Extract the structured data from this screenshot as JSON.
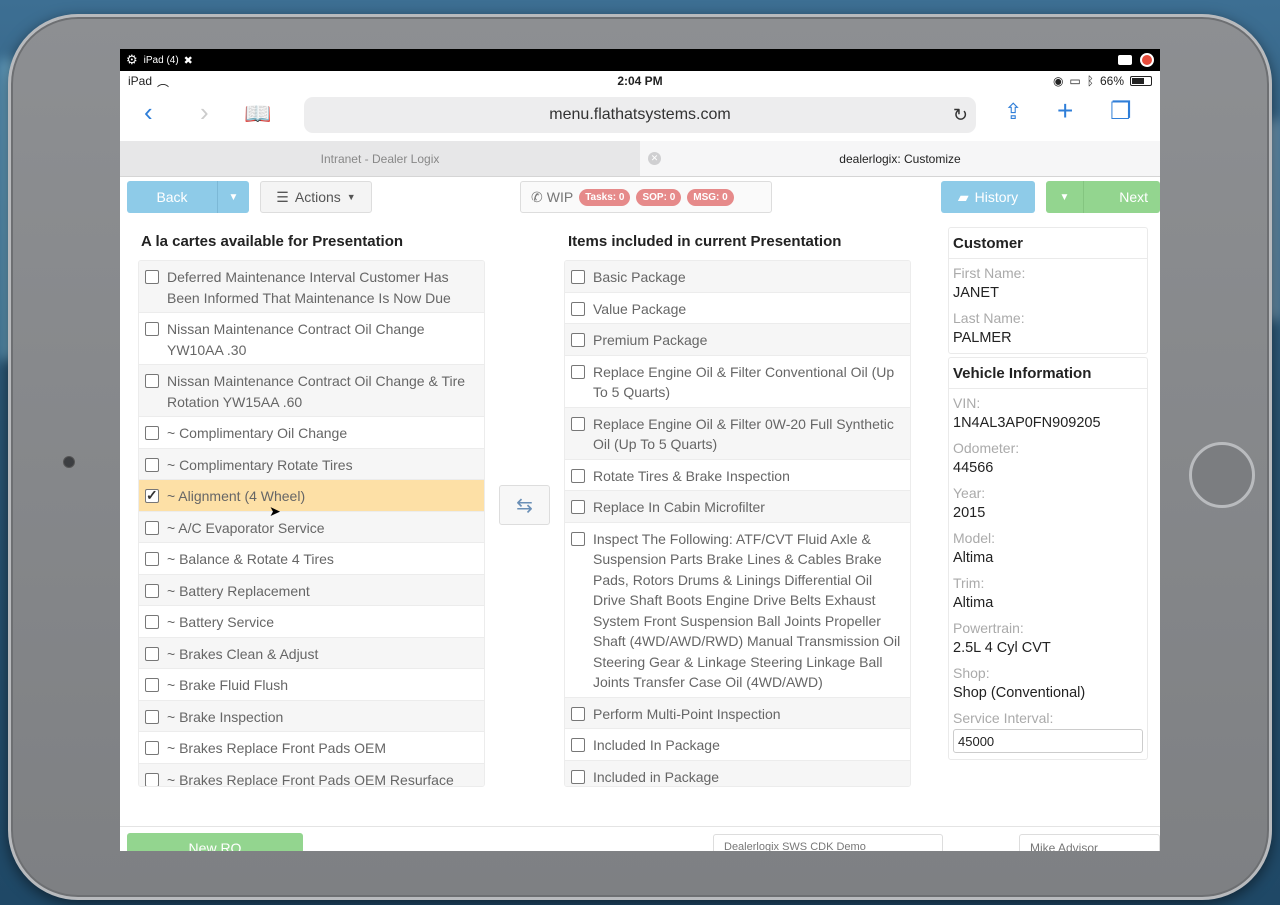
{
  "recording_bar": {
    "device_label": "iPad (4)"
  },
  "status_bar": {
    "device": "iPad",
    "time": "2:04 PM",
    "battery": "66%"
  },
  "browser": {
    "url": "menu.flathatsystems.com",
    "tabs": [
      {
        "label": "Intranet - Dealer Logix",
        "active": false
      },
      {
        "label": "dealerlogix: Customize",
        "active": true
      }
    ]
  },
  "toolbar": {
    "back_label": "Back",
    "actions_label": "Actions",
    "wip_label": "WIP",
    "tasks_badge": "Tasks: 0",
    "sop_badge": "SOP: 0",
    "msg_badge": "MSG: 0",
    "history_label": "History",
    "next_label": "Next"
  },
  "left_column": {
    "title": "A la cartes available for Presentation",
    "items": [
      {
        "label": "Deferred Maintenance Interval Customer Has Been Informed That Maintenance Is Now Due",
        "checked": false
      },
      {
        "label": "Nissan Maintenance Contract Oil Change YW10AA .30",
        "checked": false
      },
      {
        "label": "Nissan Maintenance Contract Oil Change & Tire Rotation YW15AA .60",
        "checked": false
      },
      {
        "label": "~ Complimentary Oil Change",
        "checked": false
      },
      {
        "label": "~ Complimentary Rotate Tires",
        "checked": false
      },
      {
        "label": "~ Alignment (4 Wheel)",
        "checked": true
      },
      {
        "label": "~ A/C Evaporator Service",
        "checked": false
      },
      {
        "label": "~ Balance & Rotate 4 Tires",
        "checked": false
      },
      {
        "label": "~ Battery Replacement",
        "checked": false
      },
      {
        "label": "~ Battery Service",
        "checked": false
      },
      {
        "label": "~ Brakes Clean & Adjust",
        "checked": false
      },
      {
        "label": "~ Brake Fluid Flush",
        "checked": false
      },
      {
        "label": "~ Brake Inspection",
        "checked": false
      },
      {
        "label": "~ Brakes Replace Front Pads OEM",
        "checked": false
      },
      {
        "label": "~ Brakes Replace Front Pads OEM Resurface Rotors",
        "checked": false
      }
    ]
  },
  "right_column": {
    "title": "Items included in current Presentation",
    "items": [
      {
        "label": "Basic Package",
        "checked": false
      },
      {
        "label": "Value Package",
        "checked": false
      },
      {
        "label": "Premium Package",
        "checked": false
      },
      {
        "label": "Replace Engine Oil & Filter Conventional Oil (Up To 5 Quarts)",
        "checked": false
      },
      {
        "label": "Replace Engine Oil & Filter 0W-20 Full Synthetic Oil (Up To 5 Quarts)",
        "checked": false
      },
      {
        "label": "Rotate Tires & Brake Inspection",
        "checked": false
      },
      {
        "label": "Replace In Cabin Microfilter",
        "checked": false
      },
      {
        "label": "Inspect The Following: ATF/CVT Fluid Axle & Suspension Parts Brake Lines & Cables Brake Pads, Rotors Drums & Linings Differential Oil Drive Shaft Boots Engine Drive Belts Exhaust System Front Suspension Ball Joints Propeller Shaft (4WD/AWD/RWD) Manual Transmission Oil Steering Gear & Linkage Steering Linkage Ball Joints Transfer Case Oil (4WD/AWD)",
        "checked": false
      },
      {
        "label": "Perform Multi-Point Inspection",
        "checked": false
      },
      {
        "label": "Included In Package",
        "checked": false
      },
      {
        "label": "Included in Package",
        "checked": false
      }
    ]
  },
  "customer": {
    "title": "Customer",
    "first_name_label": "First Name:",
    "first_name": "JANET",
    "last_name_label": "Last Name:",
    "last_name": "PALMER"
  },
  "vehicle": {
    "title": "Vehicle Information",
    "vin_label": "VIN:",
    "vin": "1N4AL3AP0FN909205",
    "odometer_label": "Odometer:",
    "odometer": "44566",
    "year_label": "Year:",
    "year": "2015",
    "model_label": "Model:",
    "model": "Altima",
    "trim_label": "Trim:",
    "trim": "Altima",
    "powertrain_label": "Powertrain:",
    "powertrain": "2.5L 4 Cyl CVT",
    "shop_label": "Shop:",
    "shop": "Shop (Conventional)",
    "service_interval_label": "Service Interval:",
    "service_interval": "45000"
  },
  "footer": {
    "new_ro_label": "New RO",
    "dealer_select": "Dealerlogix SWS CDK Demo",
    "advisor_select": "Mike Advisor"
  },
  "colors": {
    "accent_blue": "#8ecbe8",
    "accent_green": "#93d58f",
    "badge_red": "#e68a8a",
    "selected_row": "#fde0a6",
    "link_blue": "#2f7ed8"
  }
}
